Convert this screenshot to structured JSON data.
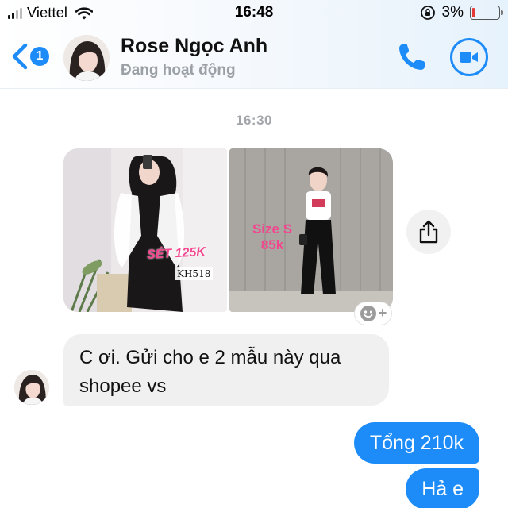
{
  "status_bar": {
    "carrier": "Viettel",
    "time": "16:48",
    "battery_percent": "3%",
    "battery_level": 0.03
  },
  "header": {
    "back_count": "1",
    "contact_name": "Rose Ngọc Anh",
    "contact_status": "Đang hoạt động",
    "accent_color": "#1d8cf8"
  },
  "conversation": {
    "timestamp": "16:30",
    "photos": [
      {
        "overlay": "SÉT 125K",
        "code": "KH518"
      },
      {
        "overlay_line1": "Size S",
        "overlay_line2": "85k"
      }
    ],
    "incoming_message": "C ơi. Gửi cho e 2 mẫu này qua shopee vs",
    "outgoing_messages": [
      "Tổng 210k",
      "Hả e"
    ]
  },
  "icons": {
    "back": "chevron-left-icon",
    "call": "phone-icon",
    "video": "video-camera-icon",
    "share": "share-icon",
    "reaction": "smiley-plus-icon",
    "wifi": "wifi-icon",
    "lock": "orientation-lock-icon"
  }
}
